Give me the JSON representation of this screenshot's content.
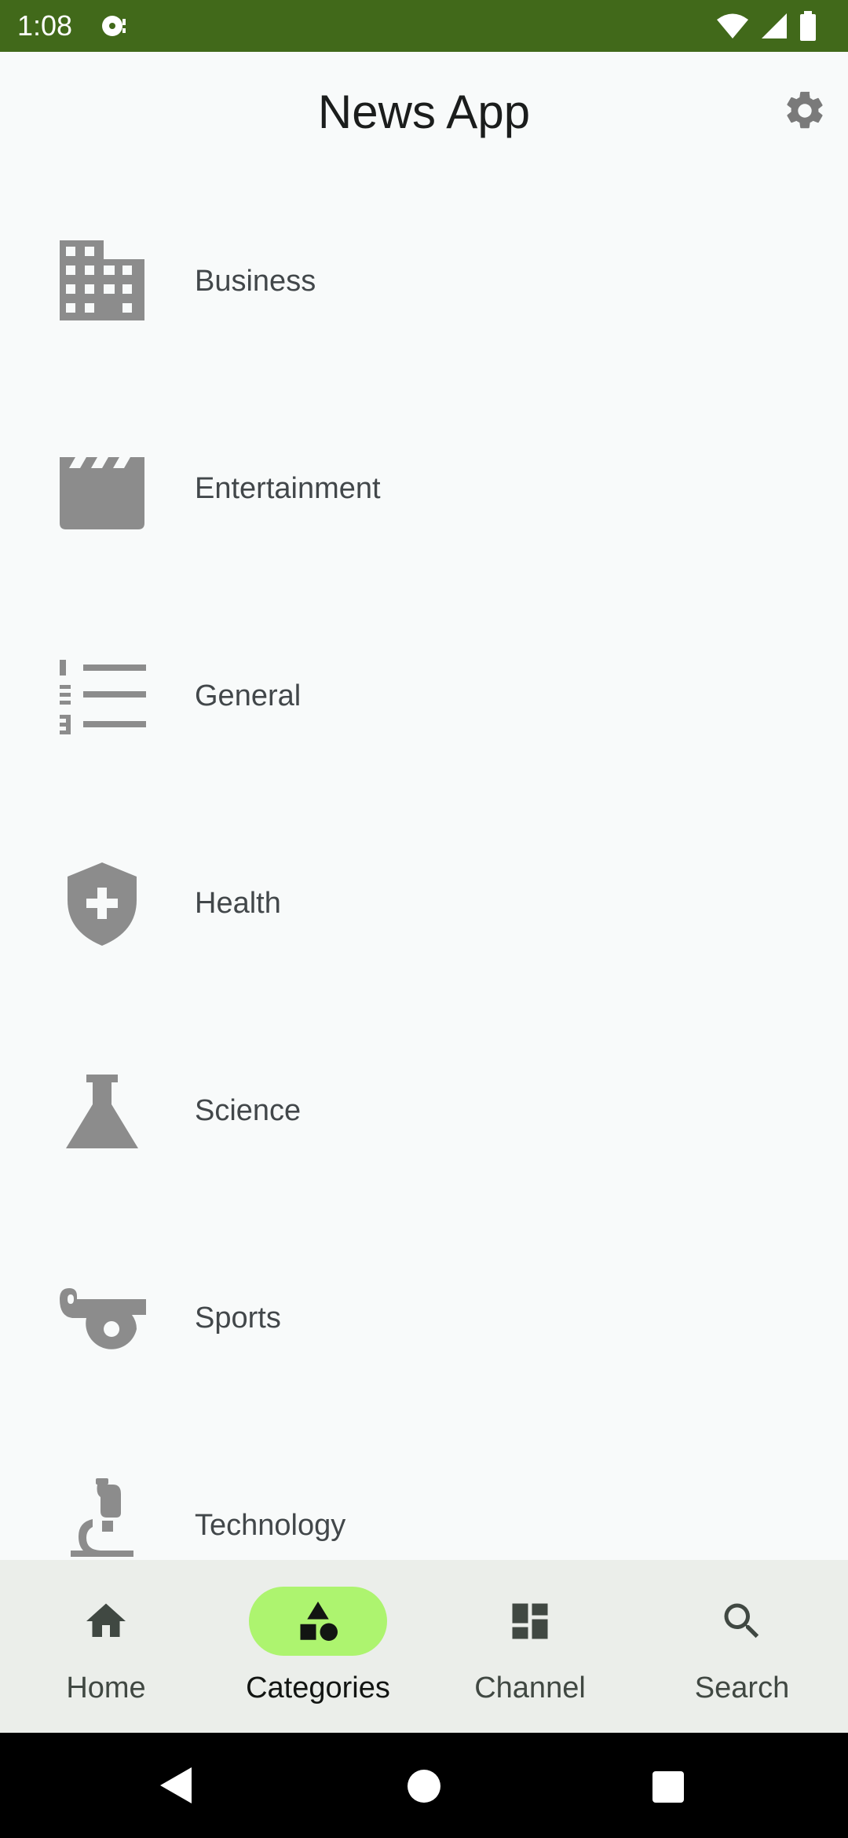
{
  "status_bar": {
    "time": "1:08",
    "background": "#41691a",
    "icons": [
      "media-icon",
      "wifi-icon",
      "signal-icon",
      "battery-icon"
    ]
  },
  "app_bar": {
    "title": "News App",
    "action_icon": "gear-icon"
  },
  "categories": [
    {
      "label": "Business",
      "icon": "building-icon"
    },
    {
      "label": "Entertainment",
      "icon": "clapperboard-icon"
    },
    {
      "label": "General",
      "icon": "numbered-list-icon"
    },
    {
      "label": "Health",
      "icon": "health-shield-icon"
    },
    {
      "label": "Science",
      "icon": "flask-icon"
    },
    {
      "label": "Sports",
      "icon": "whistle-icon"
    },
    {
      "label": "Technology",
      "icon": "microscope-icon"
    }
  ],
  "bottom_nav": {
    "active_color": "#adf46f",
    "items": [
      {
        "label": "Home",
        "icon": "home-icon",
        "active": false
      },
      {
        "label": "Categories",
        "icon": "categories-icon",
        "active": true
      },
      {
        "label": "Channel",
        "icon": "dashboard-icon",
        "active": false
      },
      {
        "label": "Search",
        "icon": "search-icon",
        "active": false
      }
    ]
  },
  "system_nav": {
    "buttons": [
      "back-icon",
      "home-circle-icon",
      "recents-icon"
    ]
  }
}
